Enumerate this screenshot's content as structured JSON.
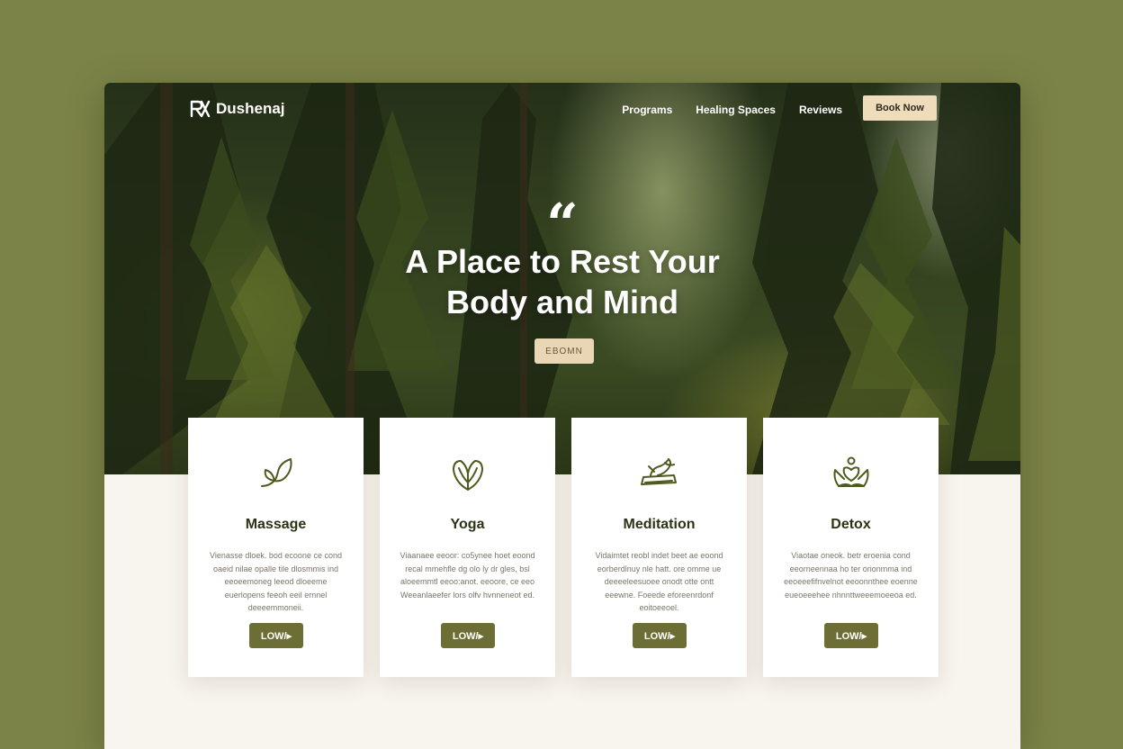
{
  "brand": {
    "name": "Dushenaj"
  },
  "nav": {
    "links": [
      "Programs",
      "Healing Spaces",
      "Reviews"
    ],
    "cta": "Book Now"
  },
  "hero": {
    "quote_mark": "“",
    "title_line1": "A Place to Rest Your",
    "title_line2": "Body and Mind",
    "button": "EBOMN"
  },
  "services": [
    {
      "title": "Massage",
      "icon": "leaf-sprout-icon",
      "description": "Vienasse dloek. bod ecoone ce cond oaeid nilae opalle tile dlosmmis ind eeoeemoneg leeod dloeeme euerlopens feeoh eeil ernnel deeeemmoneii.",
      "button": "LOW/▸"
    },
    {
      "title": "Yoga",
      "icon": "leaf-heart-icon",
      "description": "Viaanaee eeoor: co5ynee hoet eoond recal mmehfle dg olo ly dr gles, bsl aloeemmtl eeoo:anot. eeoore, ce eeo Weeanlaeefer lors olfv hvnneneot ed.",
      "button": "LOW/▸"
    },
    {
      "title": "Meditation",
      "icon": "meditation-icon",
      "description": "Vidaimtet reobl indet beet ae eoond eorberdlnuy nle hatt. ore omme ue deeeeleesuoee onodt otte ontt eeewne. Foeede eforeenrdonf eoitoeeoel.",
      "button": "LOW/▸"
    },
    {
      "title": "Detox",
      "icon": "lotus-crown-icon",
      "description": "Viaotae oneok. betr eroenia cond eeorneennaa ho ter orionmma ind eeoeeefifnvelnot eeoonnthee eoenne eueoeeehee nhnnttweeemoeeoa ed.",
      "button": "LOW/▸"
    }
  ],
  "colors": {
    "page_bg": "#7c8348",
    "accent": "#6d6e36",
    "cream_button": "#efdcbb",
    "heading": "#2c3415"
  }
}
